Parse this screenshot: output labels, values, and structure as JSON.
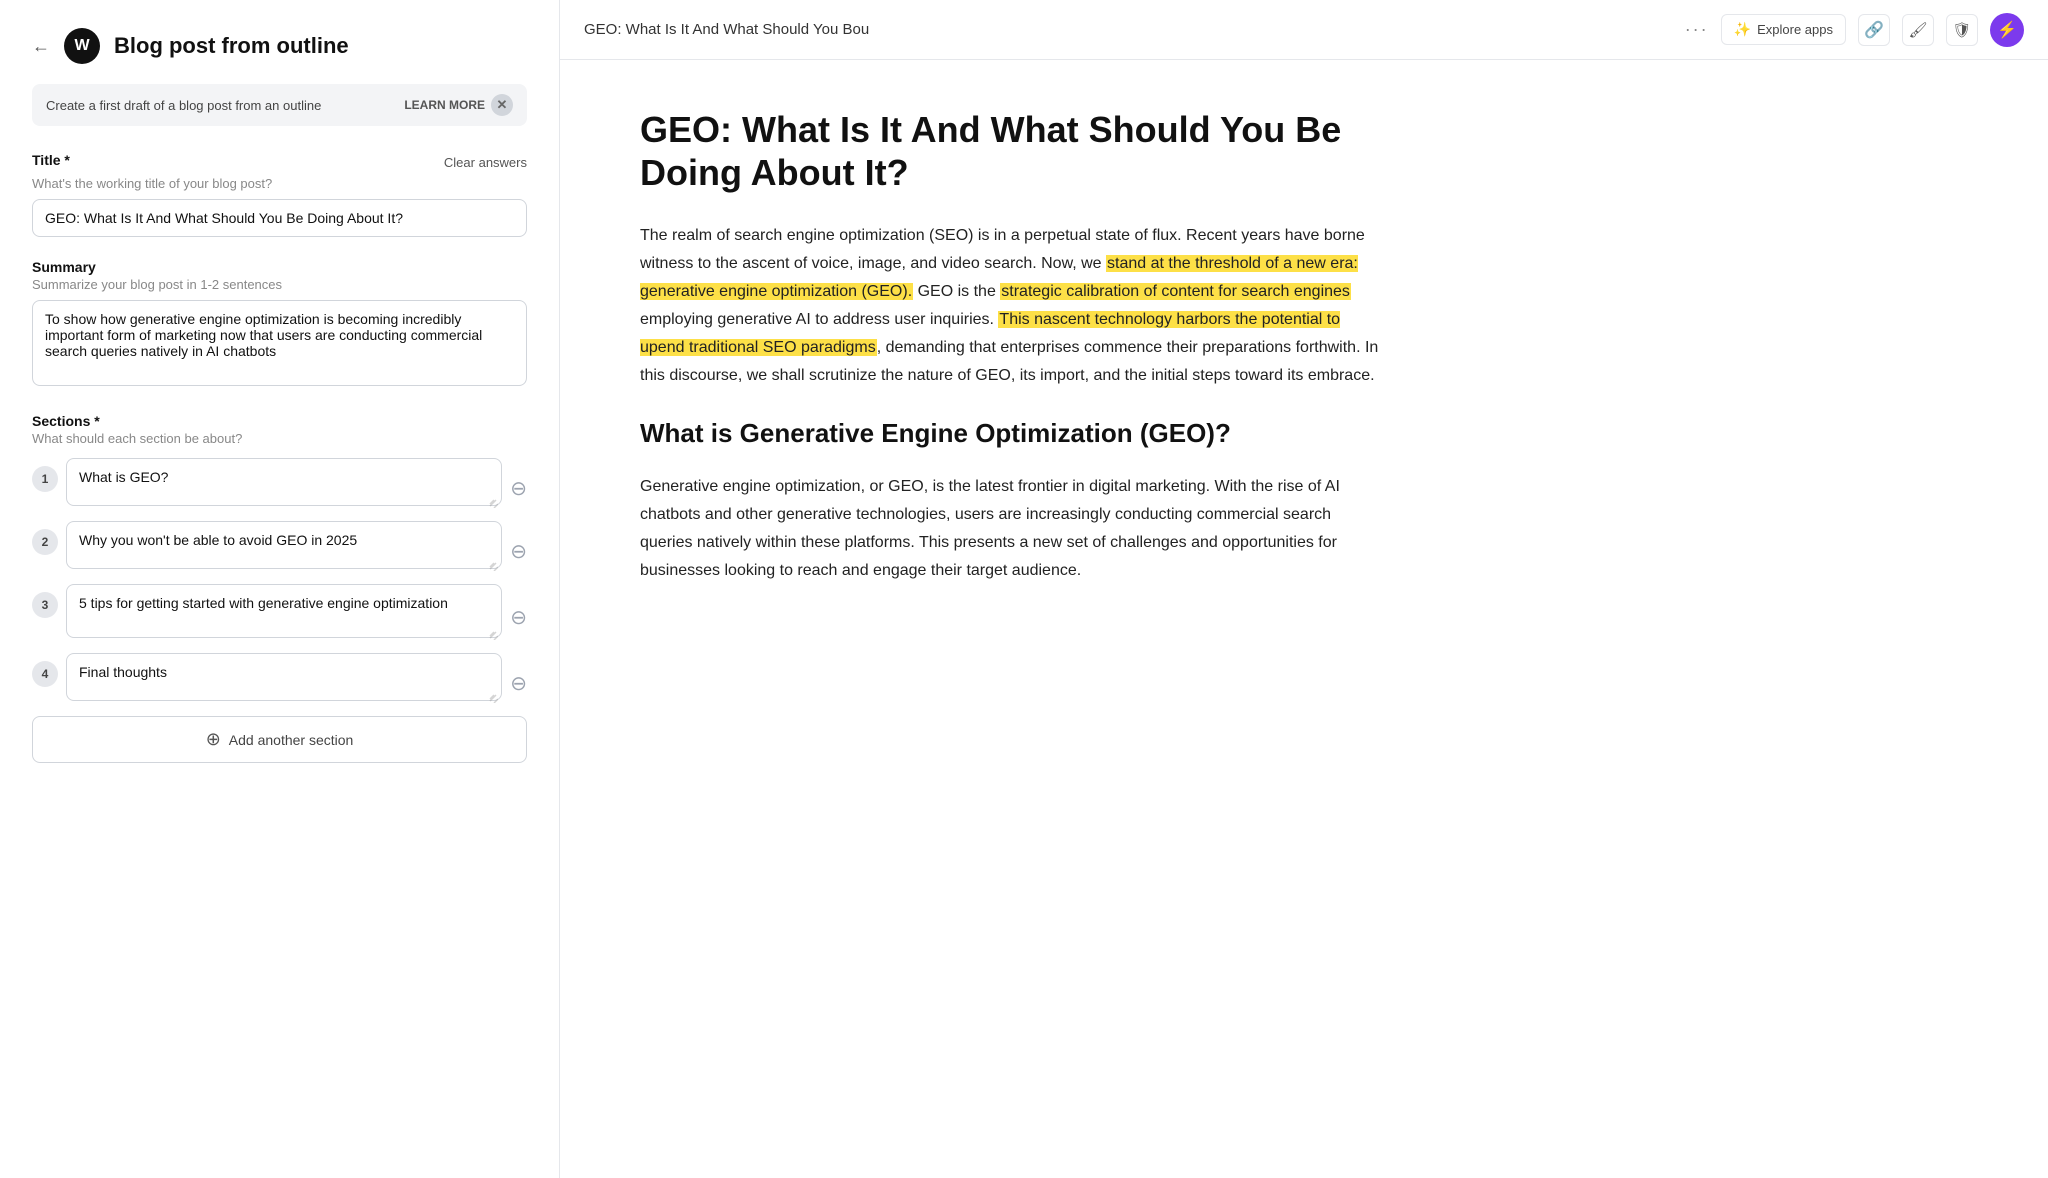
{
  "app": {
    "logo": "W",
    "page_title": "Blog post from outline",
    "back_arrow": "←"
  },
  "subtitle": {
    "text": "Create a first draft of a blog post from an outline",
    "learn_more": "LEARN MORE",
    "close_icon": "✕"
  },
  "form": {
    "title_label": "Title *",
    "title_hint": "What's the working title of your blog post?",
    "clear_label": "Clear answers",
    "title_value": "GEO: What Is It And What Should You Be Doing About It?",
    "summary_label": "Summary",
    "summary_hint": "Summarize your blog post in 1-2 sentences",
    "summary_value": "To show how generative engine optimization is becoming incredibly important form of marketing now that users are conducting commercial search queries natively in AI chatbots",
    "sections_label": "Sections *",
    "sections_hint": "What should each section be about?",
    "sections": [
      {
        "number": "1",
        "value": "What is GEO?"
      },
      {
        "number": "2",
        "value": "Why you won't be able to avoid GEO in 2025"
      },
      {
        "number": "3",
        "value": "5 tips for getting started with generative engine optimization"
      },
      {
        "number": "4",
        "value": "Final thoughts"
      }
    ],
    "add_section_label": "Add another section"
  },
  "document": {
    "tab_title": "GEO: What Is It And What Should You Bou",
    "more_label": "···",
    "explore_apps_label": "Explore apps",
    "main_title": "GEO: What Is It And What Should You Be Doing About It?",
    "intro_paragraph_before_highlight1": "The realm of search engine optimization (SEO) is in a perpetual state of flux. Recent years have borne witness to the ascent of voice, image, and video search. Now, we ",
    "highlight1": "stand at the threshold of a new era: generative engine optimization (GEO).",
    "intro_paragraph_middle": " GEO is the ",
    "highlight2": "strategic calibration of content for search engines",
    "intro_paragraph_middle2": " employing generative AI to address user inquiries. ",
    "highlight3": "This nascent technology harbors the potential to upend traditional SEO paradigms",
    "intro_paragraph_after": ", demanding that enterprises commence their preparations forthwith. In this discourse, we shall scrutinize the nature of GEO, its import, and the initial steps toward its embrace.",
    "section1_title": "What is Generative Engine Optimization (GEO)?",
    "section1_paragraph": "Generative engine optimization, or GEO, is the latest frontier in digital marketing. With the rise of AI chatbots and other generative technologies, users are increasingly conducting commercial search queries natively within these platforms. This presents a new set of challenges and opportunities for businesses looking to reach and engage their target audience."
  }
}
